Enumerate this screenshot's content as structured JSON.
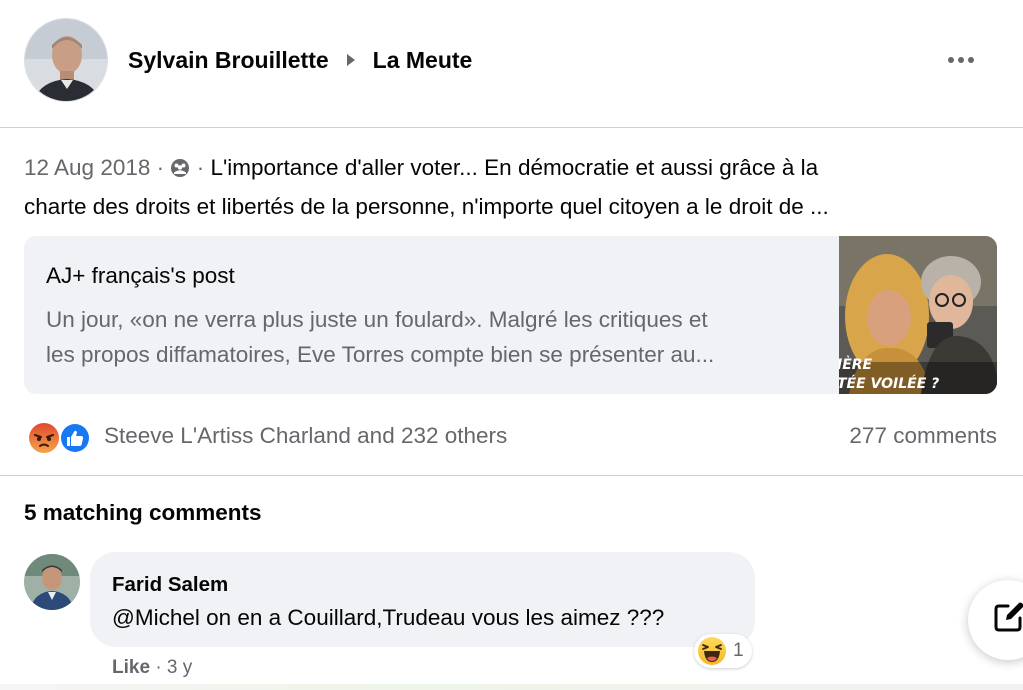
{
  "header": {
    "author_name": "Sylvain Brouillette",
    "group_name": "La Meute",
    "author_avatar_icon": "profile-photo",
    "separator_icon": "caret-right-icon",
    "more_icon": "more-options-icon"
  },
  "post": {
    "date": "12 Aug 2018",
    "separator": "·",
    "privacy_icon": "group-members-icon",
    "text_line_1": "L'importance d'aller voter... En démocratie et aussi grâce à la",
    "text_line_2": "charte des droits et libertés de la personne, n'importe quel citoyen a le droit de ..."
  },
  "shared_post": {
    "title": "AJ+ français's post",
    "body_line_1": "Un jour, «on ne verra plus juste un foulard». Malgré les critiques et",
    "body_line_2": "les propos diffamatoires, Eve Torres compte bien se présenter au...",
    "thumbnail_caption_1": "IÈRE",
    "thumbnail_caption_2": "TÉE VOILÉE ?"
  },
  "reactions": {
    "icons": [
      "angry-reaction-icon",
      "like-reaction-icon"
    ],
    "summary": "Steeve L'Artiss Charland and 232 others",
    "comments_count": "277 comments"
  },
  "comments": {
    "heading": "5 matching comments",
    "items": [
      {
        "author": "Farid Salem",
        "text": "@Michel on en a Couillard,Trudeau vous les aimez ???",
        "reaction_icon": "haha-reaction-icon",
        "reaction_count": "1",
        "like_label": "Like",
        "separator": "·",
        "age": "3 y"
      }
    ]
  },
  "compose_icon": "edit-compose-icon",
  "colors": {
    "text_primary": "#050505",
    "text_secondary": "#65676b",
    "card_background": "#f0f2f5",
    "divider": "#ced0d4",
    "like_blue": "#1877f2",
    "angry_orange": "#f26a1b"
  }
}
